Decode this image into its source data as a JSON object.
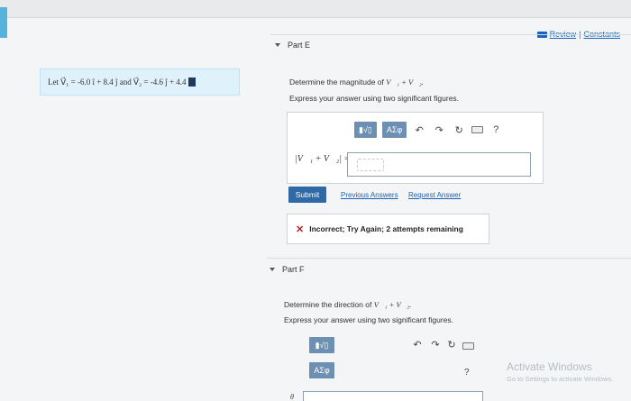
{
  "header": {
    "review_label": "Review",
    "separator": "|",
    "constants_label": "Constants"
  },
  "given": {
    "text": "Let V⃗₁ = -6.0 î + 8.4 ĵ and V⃗₂ = -4.6 ĵ + 4.4"
  },
  "part_e": {
    "title": "Part E",
    "prompt_prefix": "Determine the magnitude of ",
    "prompt_math": "V⃗₁ + V⃗₂.",
    "instruction": "Express your answer using two significant figures.",
    "toolbar": {
      "template_label": "▮√▯",
      "greek_label": "ΑΣφ",
      "undo": "↶",
      "redo": "↷",
      "reset": "↻",
      "help": "?"
    },
    "formula_label": "|V⃗₁ + V⃗₂| =",
    "answer_value": "",
    "submit_label": "Submit",
    "previous_answers_label": "Previous Answers",
    "request_answer_label": "Request Answer",
    "feedback_icon": "✕",
    "feedback_text": "Incorrect; Try Again; 2 attempts remaining"
  },
  "part_f": {
    "title": "Part F",
    "prompt_prefix": "Determine the direction of ",
    "prompt_math": "V⃗₁ + V⃗₂.",
    "instruction": "Express your answer using two significant figures.",
    "toolbar": {
      "template_label": "▮√▯",
      "greek_label": "ΑΣφ",
      "undo": "↶",
      "redo": "↷",
      "reset": "↻",
      "help": "?"
    },
    "formula_label": "θ",
    "answer_value": ""
  },
  "watermark": {
    "line1": "Activate Windows",
    "line2": "Go to Settings to activate Windows."
  }
}
